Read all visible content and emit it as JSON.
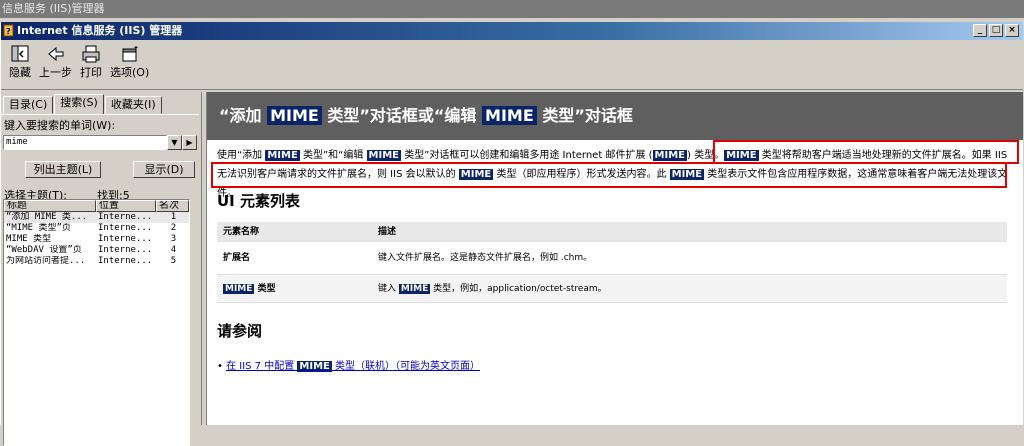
{
  "outer_title": "信息服务 (IIS)管理器",
  "window": {
    "title": "Internet 信息服务 (IIS) 管理器",
    "buttons": [
      "_",
      "□",
      "×"
    ]
  },
  "toolbar": {
    "items": [
      {
        "label": "隐藏",
        "icon": "hide-icon"
      },
      {
        "label": "上一步",
        "icon": "back-icon"
      },
      {
        "label": "打印",
        "icon": "print-icon"
      },
      {
        "label": "选项(O)",
        "icon": "options-icon"
      }
    ]
  },
  "left_pane": {
    "tabs": [
      "目录(C)",
      "搜索(S)",
      "收藏夹(I)"
    ],
    "active_tab": 1,
    "keyword_label": "键入要搜索的单词(W):",
    "keyword_value": "mime",
    "list_topics_button": "列出主题(L)",
    "display_button": "显示(D)",
    "select_topic_label": "选择主题(T):",
    "found_label": "找到:5",
    "columns": [
      "标题",
      "位置",
      "名次"
    ],
    "results": [
      {
        "title": "“添加 MIME 类...",
        "location": "Interne...",
        "rank": "1"
      },
      {
        "title": "“MIME 类型”页",
        "location": "Interne...",
        "rank": "2"
      },
      {
        "title": "MIME 类型",
        "location": "Interne...",
        "rank": "3"
      },
      {
        "title": "“WebDAV 设置”页",
        "location": "Interne...",
        "rank": "4"
      },
      {
        "title": "为网站访问者提...",
        "location": "Interne...",
        "rank": "5"
      }
    ]
  },
  "content": {
    "banner": {
      "pre": "“添加 ",
      "mime1": "MIME",
      "mid": " 类型”对话框或“编辑 ",
      "mime2": "MIME",
      "post": " 类型”对话框"
    },
    "paragraph": {
      "p1": "使用“添加 ",
      "h1": "MIME",
      "p2": " 类型”和“编辑 ",
      "h2": "MIME",
      "p3": " 类型”对话框可以创建和编辑多用途 Internet 邮件扩展 (",
      "h3": "MIME",
      "p4": ") 类型。",
      "h4": "MIME",
      "p5": " 类型将帮助客户端适当地处理新的文件扩展名。如果 IIS 无法识别客户端请求的文件扩展名，则 IIS 会以默认的 ",
      "h5": "MIME",
      "p6": " 类型（即应用程序）形式发送内容。此 ",
      "h6": "MIME",
      "p7": " 类型表示文件包含应用程序数据，这通常意味着客户端无法处理该文件。"
    },
    "ui_heading": "UI 元素列表",
    "table": {
      "headers": [
        "元素名称",
        "描述"
      ],
      "row1": {
        "name": "扩展名",
        "desc": "键入文件扩展名。这是静态文件扩展名，例如 .chm。"
      },
      "row2": {
        "name_hl": "MIME",
        "name_rest": " 类型",
        "desc_pre": "键入 ",
        "desc_hl": "MIME",
        "desc_post": " 类型，例如，application/octet-stream。"
      }
    },
    "see_also_heading": "请参阅",
    "link": {
      "pre": "在 IIS 7 中配置 ",
      "hl": "MIME",
      "post": " 类型（联机）（可能为英文页面）"
    }
  }
}
